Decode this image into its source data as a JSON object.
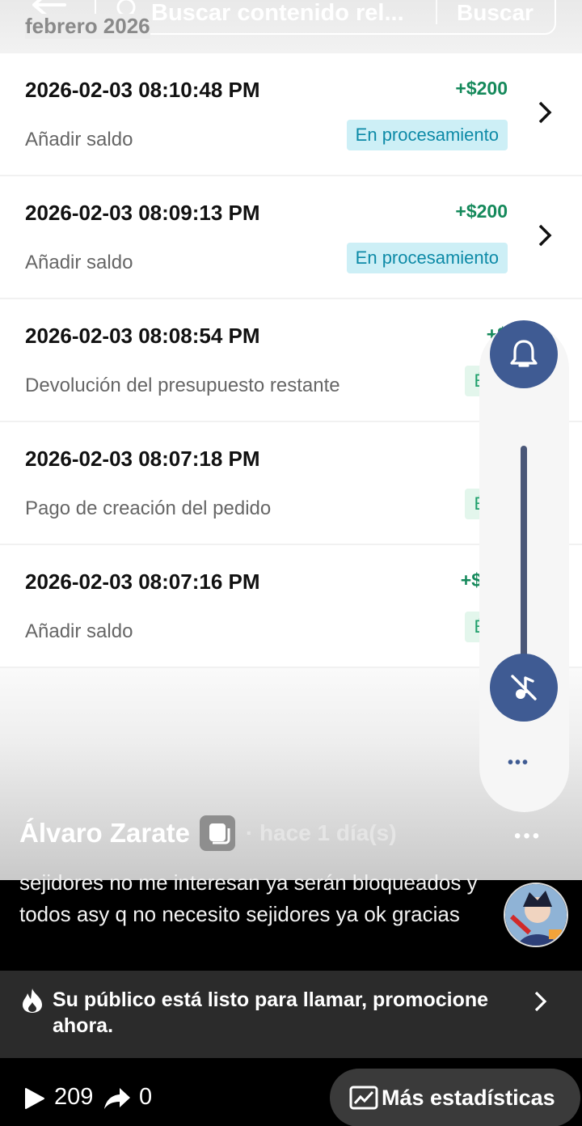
{
  "header": {
    "search_placeholder": "Buscar contenido rel...",
    "search_button": "Buscar",
    "month_label": "febrero 2026"
  },
  "transactions": [
    {
      "datetime": "2026-02-03 08:10:48 PM",
      "description": "Añadir saldo",
      "amount": "+$200",
      "status": "En procesamiento"
    },
    {
      "datetime": "2026-02-03 08:09:13 PM",
      "description": "Añadir saldo",
      "amount": "+$200",
      "status": "En procesamiento"
    },
    {
      "datetime": "2026-02-03 08:08:54 PM",
      "description": "Devolución del presupuesto restante",
      "amount": "+$",
      "status": "Éxi"
    },
    {
      "datetime": "2026-02-03 08:07:18 PM",
      "description": "Pago de creación del pedido",
      "amount": "-$",
      "status": "Éxi"
    },
    {
      "datetime": "2026-02-03 08:07:16 PM",
      "description": "Añadir saldo",
      "amount": "+$66,",
      "status": "Éxi"
    }
  ],
  "side_panel": {
    "bell_icon": "bell-icon",
    "mute_icon": "music-off-icon",
    "more": "•••"
  },
  "post": {
    "author": "Álvaro Zarate",
    "time": "· hace 1 día(s)",
    "more": "•••",
    "text": "sejidores no me interesan ya serán bloqueados y todos asy q no necesito sejidores ya ok gracias"
  },
  "promo": {
    "text": "Su público está listo para llamar, promocione ahora."
  },
  "stats": {
    "views": "209",
    "shares": "0",
    "more_stats_label": "Más estadísticas"
  },
  "colors": {
    "positive_amount": "#15895b",
    "processing_badge_bg": "#cdeff6",
    "success_badge_bg": "#e3f6ec",
    "panel_button": "#3f5b93"
  }
}
